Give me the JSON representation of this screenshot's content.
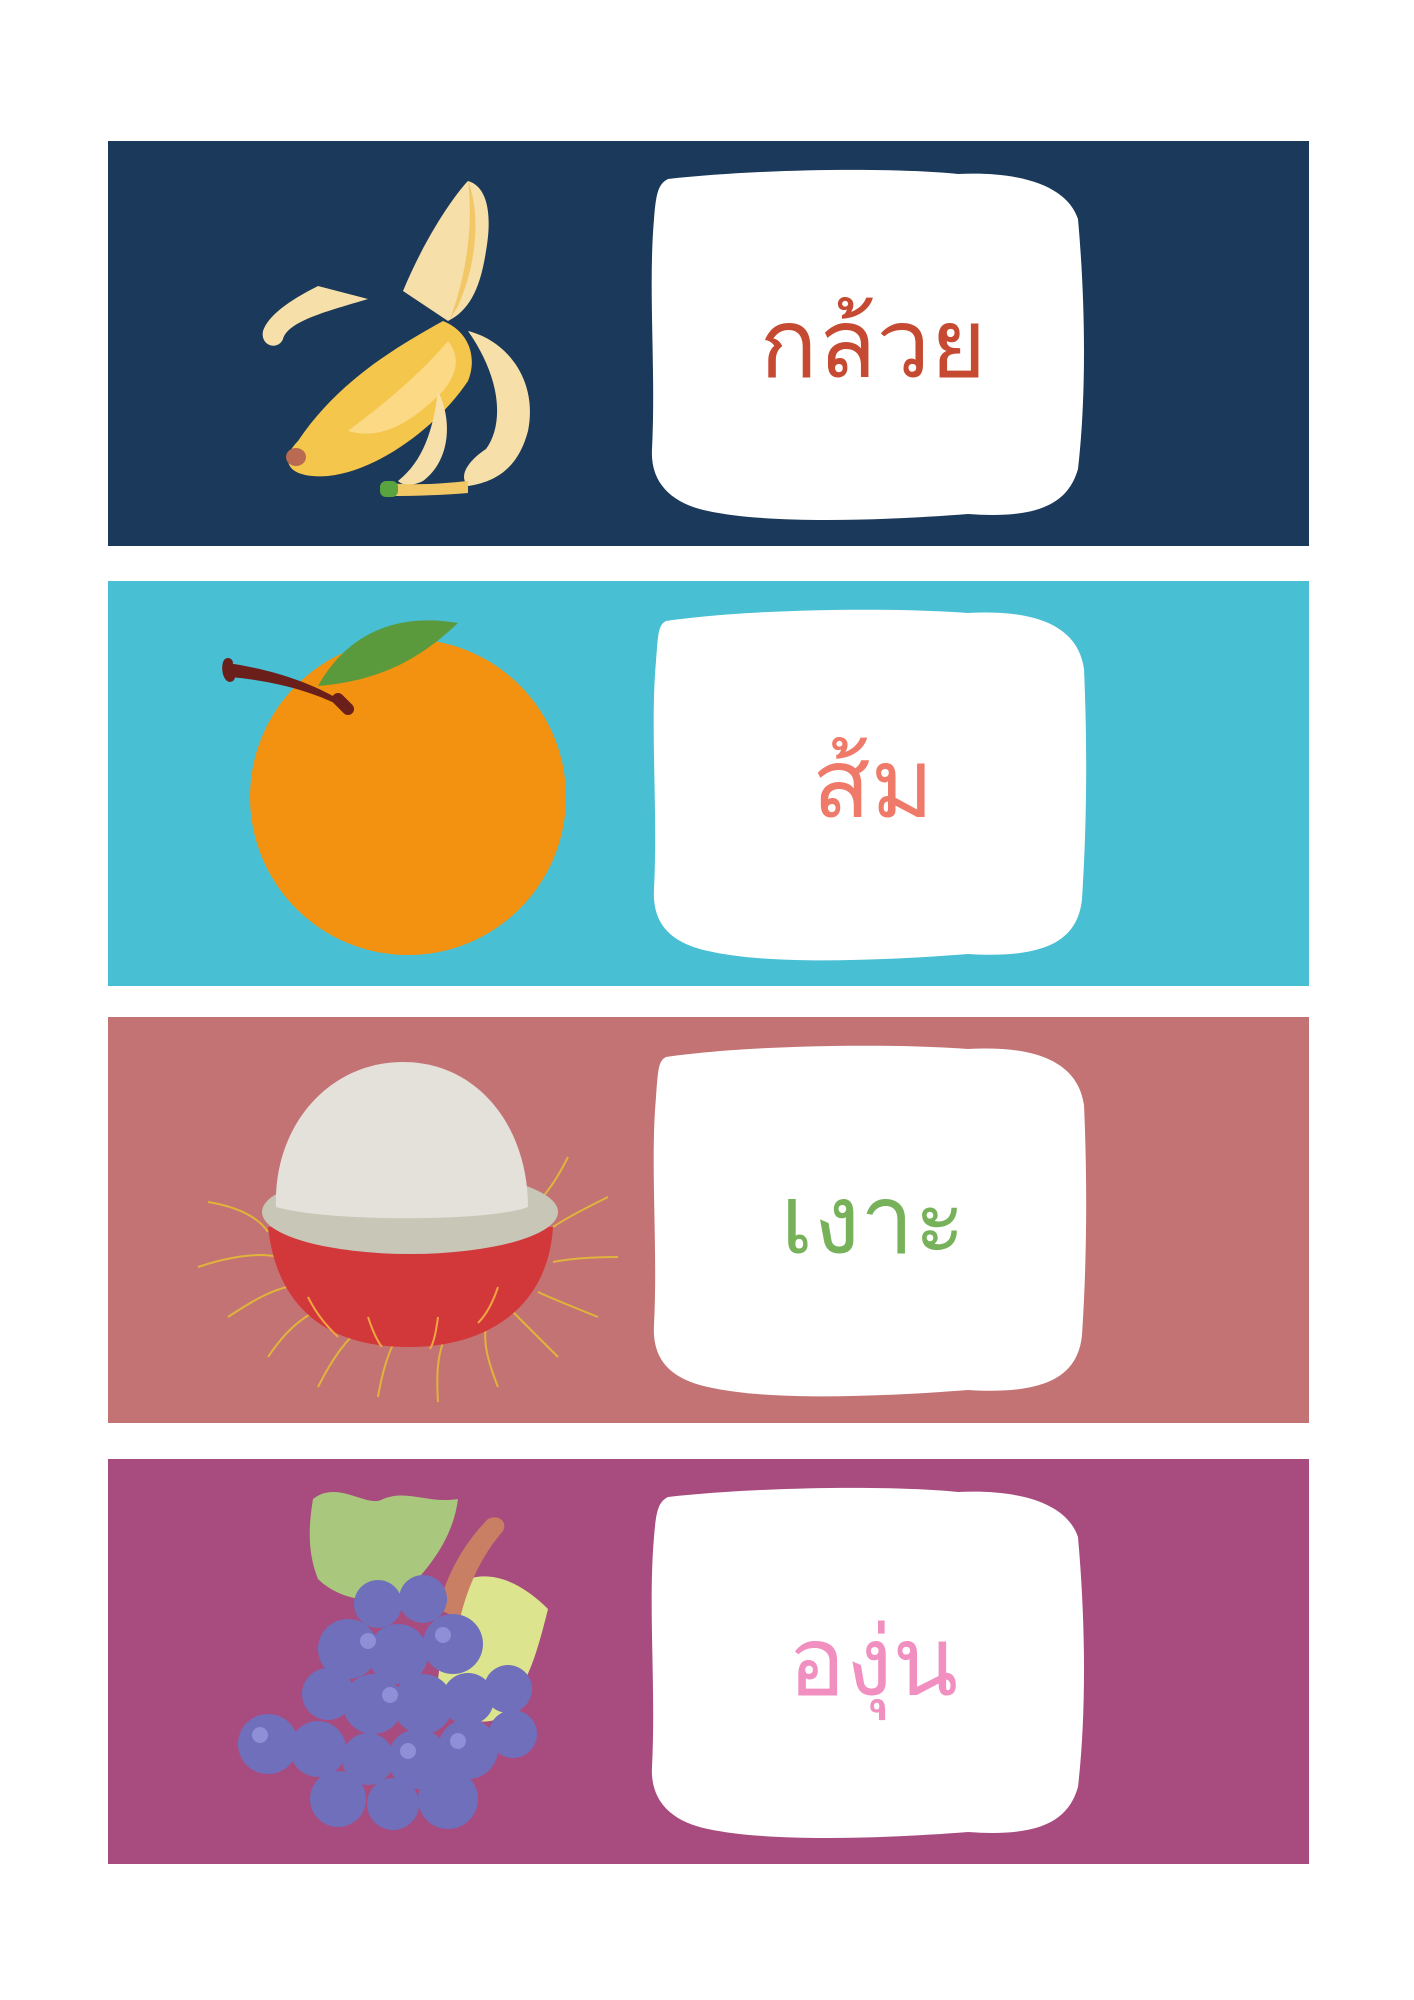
{
  "cards": [
    {
      "fruit": "banana-icon",
      "word": "กล้วย",
      "bg_color": "#1b395a",
      "text_color": "#c64a32"
    },
    {
      "fruit": "orange-icon",
      "word": "ส้ม",
      "bg_color": "#49bfd3",
      "text_color": "#ef7a69"
    },
    {
      "fruit": "rambutan-icon",
      "word": "เงาะ",
      "bg_color": "#c47374",
      "text_color": "#77b25a"
    },
    {
      "fruit": "grapes-icon",
      "word": "องุ่น",
      "bg_color": "#a84b7f",
      "text_color": "#f08fc0"
    }
  ]
}
